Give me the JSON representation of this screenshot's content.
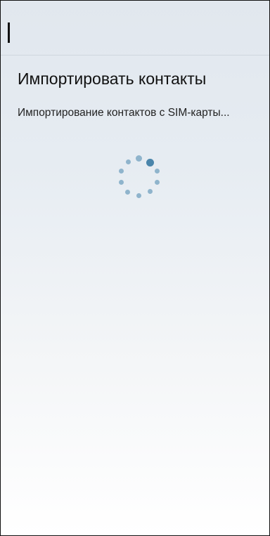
{
  "dialog": {
    "title": "Импортировать контакты",
    "message": "Импортирование контактов с SIM-карты..."
  },
  "icons": {
    "spinner": "loading-spinner-icon"
  },
  "colors": {
    "spinner_dot": "#8fb4cc",
    "spinner_dot_active": "#4a85ab",
    "text": "#111111"
  }
}
